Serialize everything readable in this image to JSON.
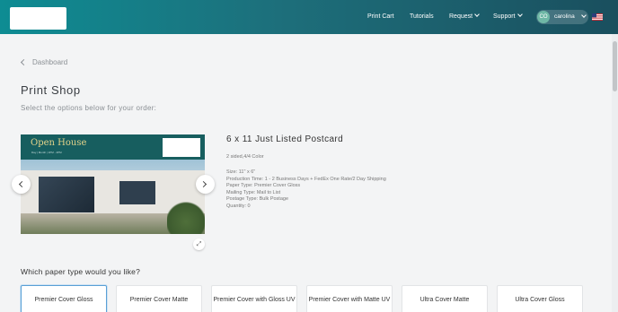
{
  "header": {
    "nav": {
      "print_cart": "Print Cart",
      "tutorials": "Tutorials",
      "request": "Request",
      "support": "Support"
    },
    "user": {
      "initials": "CO",
      "name": "carolina"
    }
  },
  "breadcrumb": {
    "back_label": "Dashboard"
  },
  "page": {
    "title": "Print Shop",
    "subtitle": "Select the options below for your order:"
  },
  "preview": {
    "headline": "Open House",
    "subline": "Day | Month | 1PM - 4PM"
  },
  "product": {
    "name": "6 x 11 Just Listed Postcard",
    "color": "2 sided,4/4 Color",
    "details": [
      "Size: 11\" x 6\"",
      "Production Time: 1 - 2 Business Days + FedEx One Rate/2 Day Shipping",
      "Paper Type: Premier Cover Gloss",
      "Mailing Type: Mail to List",
      "Postage Type: Bulk Postage",
      "Quantity: 0"
    ]
  },
  "paper": {
    "question": "Which paper type would you like?",
    "options": [
      {
        "label": "Premier Cover Gloss",
        "selected": true
      },
      {
        "label": "Premier Cover Matte",
        "selected": false
      },
      {
        "label": "Premier Cover with Gloss UV",
        "selected": false
      },
      {
        "label": "Premier Cover with Matte UV",
        "selected": false
      },
      {
        "label": "Ultra Cover Matte",
        "selected": false
      },
      {
        "label": "Ultra Cover Gloss",
        "selected": false
      }
    ]
  },
  "colors": {
    "accent": "#0e8c93",
    "header_dark": "#1a4f5e",
    "selected_border": "#5aa0d6"
  },
  "icons": [
    "back-chevron-icon",
    "chevron-down-icon",
    "us-flag-icon",
    "arrow-left-icon",
    "arrow-right-icon",
    "expand-icon"
  ]
}
